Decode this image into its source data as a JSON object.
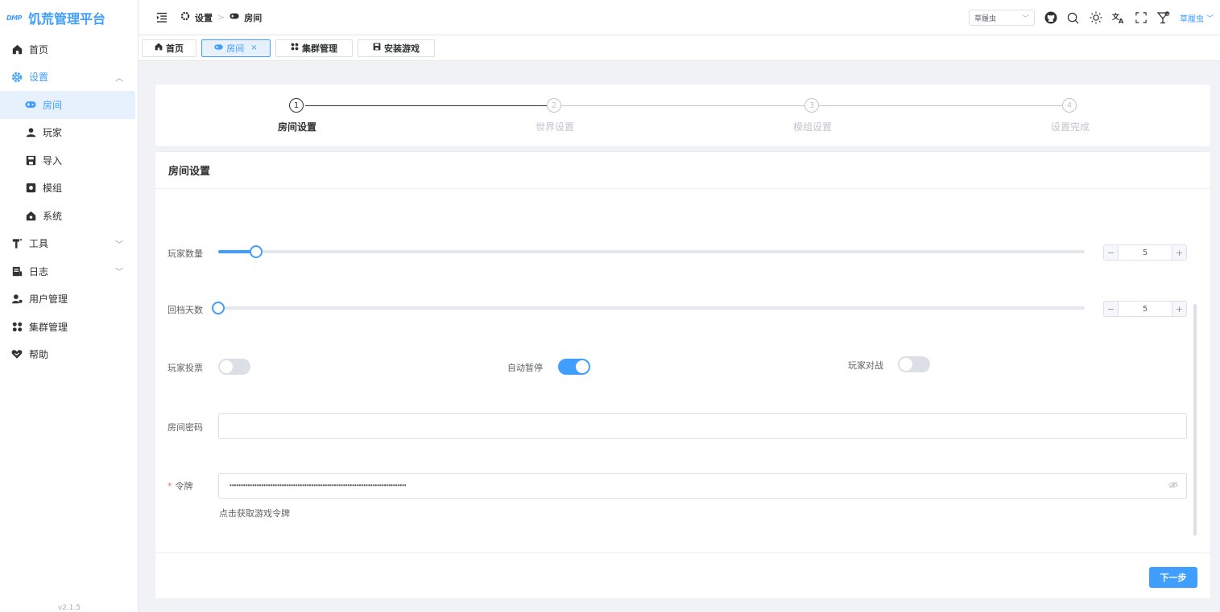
{
  "app": {
    "logo_mark": "DMP",
    "title": "饥荒管理平台",
    "version": "v2.1.5"
  },
  "sidebar": {
    "items": [
      {
        "label": "首页"
      },
      {
        "label": "设置"
      },
      {
        "label": "房间"
      },
      {
        "label": "玩家"
      },
      {
        "label": "导入"
      },
      {
        "label": "模组"
      },
      {
        "label": "系统"
      },
      {
        "label": "工具"
      },
      {
        "label": "日志"
      },
      {
        "label": "用户管理"
      },
      {
        "label": "集群管理"
      },
      {
        "label": "帮助"
      }
    ]
  },
  "header": {
    "breadcrumb": [
      "设置",
      "房间"
    ],
    "cluster_select": "草履虫",
    "user": "草履虫"
  },
  "tabs": [
    {
      "label": "首页"
    },
    {
      "label": "房间",
      "close": "×"
    },
    {
      "label": "集群管理"
    },
    {
      "label": "安装游戏"
    }
  ],
  "steps": [
    {
      "num": "1",
      "title": "房间设置"
    },
    {
      "num": "2",
      "title": "世界设置"
    },
    {
      "num": "3",
      "title": "模组设置"
    },
    {
      "num": "4",
      "title": "设置完成"
    }
  ],
  "form": {
    "title": "房间设置",
    "player_count": {
      "label": "玩家数量",
      "value": "5",
      "minus": "−",
      "plus": "+",
      "fill_fraction": 0.044
    },
    "rollback_days": {
      "label": "回档天数",
      "value": "5",
      "minus": "−",
      "plus": "+",
      "fill_fraction": 0
    },
    "vote": {
      "label": "玩家投票",
      "on": false
    },
    "auto_pause": {
      "label": "自动暂停",
      "on": true
    },
    "pvp": {
      "label": "玩家对战",
      "on": false
    },
    "password": {
      "label": "房间密码",
      "value": ""
    },
    "token": {
      "required_mark": "*",
      "label": "令牌",
      "masked": "••••••••••••••••••••••••••••••••••••••••••••••••••••••••••••••••••••••••••••••",
      "help": "点击获取游戏令牌"
    }
  },
  "footer": {
    "next": "下一步"
  },
  "colors": {
    "accent": "#409eff",
    "border": "#dcdfe6",
    "text": "#303133",
    "danger": "#f56c6c"
  }
}
